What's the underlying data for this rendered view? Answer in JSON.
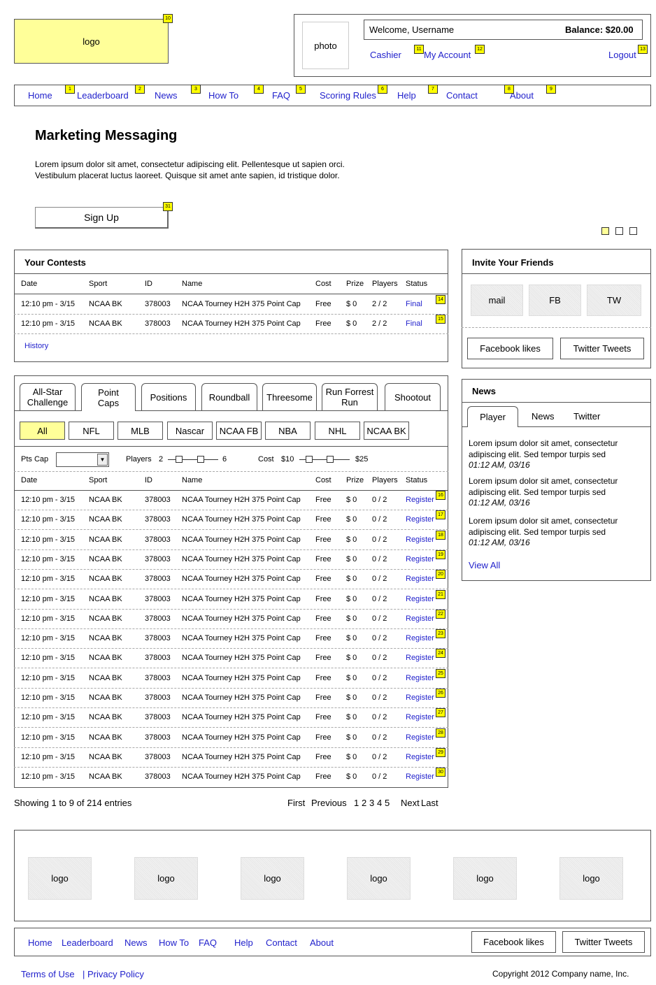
{
  "header": {
    "logo": "logo",
    "photo": "photo",
    "welcome": "Welcome, Username",
    "balance": "Balance: $20.00",
    "cashier": "Cashier",
    "my_account": "My Account",
    "logout": "Logout"
  },
  "nav": [
    "Home",
    "Leaderboard",
    "News",
    "How To",
    "FAQ",
    "Scoring Rules",
    "Help",
    "Contact",
    "About"
  ],
  "badges": {
    "b1": "1",
    "b2": "2",
    "b3": "3",
    "b4": "4",
    "b5": "5",
    "b6": "6",
    "b7": "7",
    "b8": "8",
    "b9": "9",
    "b10": "10",
    "b11": "11",
    "b12": "12",
    "b13": "13",
    "b14": "14",
    "b15": "15",
    "b31": "31"
  },
  "hero": {
    "title": "Marketing Messaging",
    "line1": "Lorem ipsum dolor sit amet, consectetur adipiscing elit. Pellentesque ut sapien orci.",
    "line2": "Vestibulum placerat luctus laoreet. Quisque sit amet ante sapien, id tristique dolor.",
    "signup": "Sign Up"
  },
  "your_contests": {
    "title": "Your Contests",
    "columns": [
      "Date",
      "Sport",
      "ID",
      "Name",
      "Cost",
      "Prize",
      "Players",
      "Status"
    ],
    "rows": [
      [
        "12:10 pm - 3/15",
        "NCAA BK",
        "378003",
        "NCAA Tourney H2H 375 Point Cap",
        "Free",
        "$ 0",
        "2 / 2",
        "Final"
      ],
      [
        "12:10 pm - 3/15",
        "NCAA BK",
        "378003",
        "NCAA Tourney H2H 375 Point Cap",
        "Free",
        "$ 0",
        "2 / 2",
        "Final"
      ]
    ],
    "history": "History"
  },
  "invite": {
    "title": "Invite Your Friends",
    "mail": "mail",
    "fb": "FB",
    "tw": "TW",
    "facebook_likes": "Facebook likes",
    "twitter_tweets": "Twitter Tweets"
  },
  "contest_tabs": [
    "All-Star Challenge",
    "Point Caps",
    "Positions",
    "Roundball",
    "Threesome",
    "Run Forrest Run",
    "Shootout"
  ],
  "sport_filters": [
    "All",
    "NFL",
    "MLB",
    "Nascar",
    "NCAA FB",
    "NBA",
    "NHL",
    "NCAA BK"
  ],
  "filters": {
    "pts_cap": "Pts Cap",
    "players": "Players",
    "players_min": "2",
    "players_max": "6",
    "cost": "Cost",
    "cost_min": "$10",
    "cost_max": "$25"
  },
  "contests": {
    "columns": [
      "Date",
      "Sport",
      "ID",
      "Name",
      "Cost",
      "Prize",
      "Players",
      "Status"
    ],
    "row_template": [
      "12:10 pm - 3/15",
      "NCAA BK",
      "378003",
      "NCAA Tourney H2H 375 Point Cap",
      "Free",
      "$ 0",
      "0 / 2",
      "Register"
    ],
    "row_badges": [
      "16",
      "17",
      "18",
      "19",
      "20",
      "21",
      "22",
      "23",
      "24",
      "25",
      "26",
      "27",
      "28",
      "29",
      "30"
    ]
  },
  "pagination": {
    "showing": "Showing 1 to 9 of 214 entries",
    "first": "First",
    "previous": "Previous",
    "pages": [
      "1",
      "2",
      "3",
      "4",
      "5"
    ],
    "next": "Next",
    "last": "Last"
  },
  "news": {
    "title": "News",
    "tabs": [
      "Player",
      "News",
      "Twitter"
    ],
    "items": [
      {
        "l1": "Lorem ipsum dolor sit amet, consectetur",
        "l2": "adipiscing elit. Sed tempor turpis sed",
        "time": "01:12 AM, 03/16"
      },
      {
        "l1": "Lorem ipsum dolor sit amet, consectetur",
        "l2": "adipiscing elit. Sed tempor turpis sed",
        "time": "01:12 AM, 03/16"
      },
      {
        "l1": "Lorem ipsum dolor sit amet, consectetur",
        "l2": "adipiscing elit. Sed tempor turpis sed",
        "time": "01:12 AM, 03/16"
      }
    ],
    "view_all": "View All"
  },
  "sponsors": [
    "logo",
    "logo",
    "logo",
    "logo",
    "logo",
    "logo"
  ],
  "footer": {
    "nav": [
      "Home",
      "Leaderboard",
      "News",
      "How To",
      "FAQ",
      "Help",
      "Contact",
      "About"
    ],
    "facebook_likes": "Facebook likes",
    "twitter_tweets": "Twitter Tweets",
    "terms": "Terms of Use",
    "privacy": "| Privacy Policy",
    "copyright": "Copyright  2012 Company name, Inc."
  },
  "colors": {
    "accent_yellow": "#ffff99",
    "badge_yellow": "#ffff00",
    "link_blue": "#2222cc"
  }
}
